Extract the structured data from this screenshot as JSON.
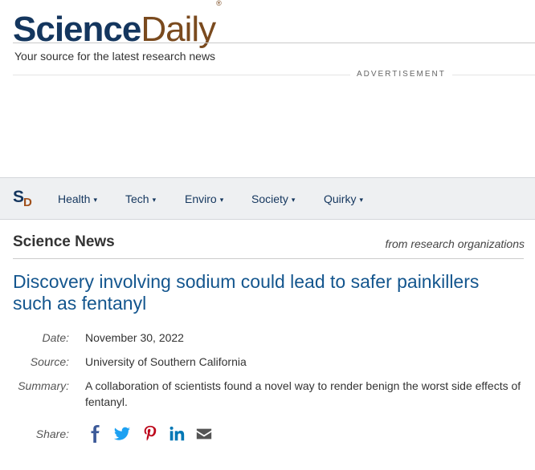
{
  "header": {
    "logo_science": "Science",
    "logo_daily": "Daily",
    "logo_reg": "®",
    "tagline": "Your source for the latest research news",
    "ad_label": "ADVERTISEMENT"
  },
  "nav": {
    "logo_s": "S",
    "logo_d": "D",
    "items": [
      {
        "label": "Health"
      },
      {
        "label": "Tech"
      },
      {
        "label": "Enviro"
      },
      {
        "label": "Society"
      },
      {
        "label": "Quirky"
      }
    ],
    "caret": "▾"
  },
  "section": {
    "title": "Science News",
    "subtitle": "from research organizations"
  },
  "article": {
    "headline": "Discovery involving sodium could lead to safer painkillers such as fentanyl",
    "date_label": "Date:",
    "date": "November 30, 2022",
    "source_label": "Source:",
    "source": "University of Southern California",
    "summary_label": "Summary:",
    "summary": "A collaboration of scientists found a novel way to render benign the worst side effects of fentanyl.",
    "share_label": "Share:"
  },
  "share_icons": [
    {
      "name": "facebook-icon",
      "color": "#3b5998"
    },
    {
      "name": "twitter-icon",
      "color": "#1da1f2"
    },
    {
      "name": "pinterest-icon",
      "color": "#bd081c"
    },
    {
      "name": "linkedin-icon",
      "color": "#0077b5"
    },
    {
      "name": "email-icon",
      "color": "#555555"
    }
  ]
}
